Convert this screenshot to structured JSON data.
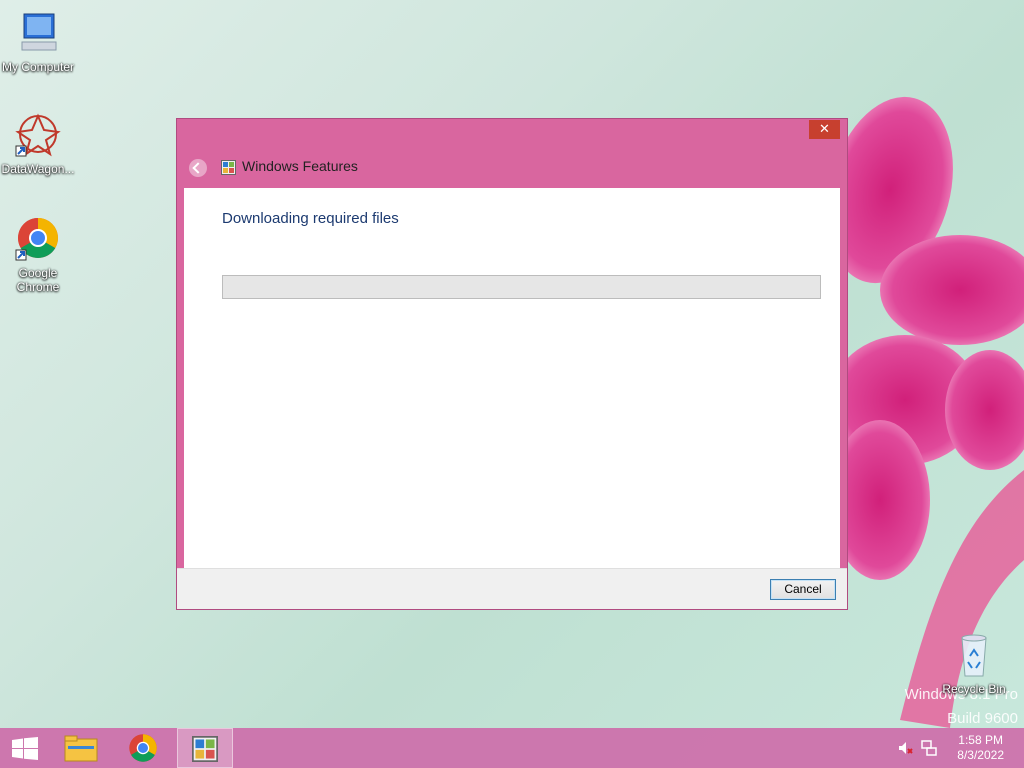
{
  "desktop": {
    "icons": [
      {
        "label": "My Computer"
      },
      {
        "label": "DataWagon..."
      },
      {
        "label": "Google Chrome"
      },
      {
        "label": "Recycle Bin"
      }
    ],
    "watermark": {
      "line1": "Windows 8.1 Pro",
      "line2": "Build 9600"
    }
  },
  "dialog": {
    "title": "Windows Features",
    "close_label": "✕",
    "heading": "Downloading required files",
    "progress_fraction": 0.0,
    "cancel_label": "Cancel"
  },
  "taskbar": {
    "items": [
      "start-button",
      "file-explorer",
      "google-chrome",
      "windows-features"
    ],
    "clock": {
      "time": "1:58 PM",
      "date": "8/3/2022"
    }
  },
  "colors": {
    "dialog_frame": "#d9669f",
    "taskbar": "#cd6eaa",
    "heading_text": "#1c3a70"
  }
}
